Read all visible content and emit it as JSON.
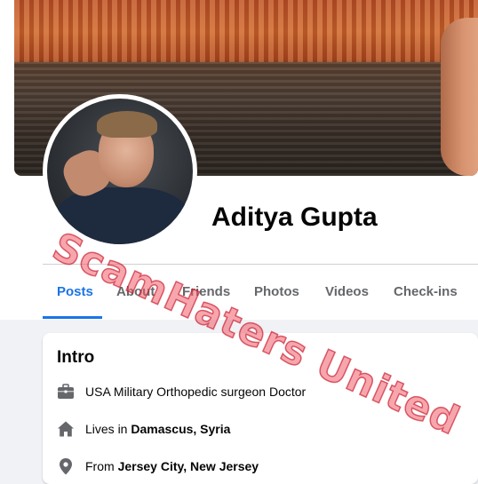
{
  "profile": {
    "name": "Aditya Gupta"
  },
  "tabs": [
    {
      "label": "Posts",
      "active": true
    },
    {
      "label": "About",
      "active": false
    },
    {
      "label": "Friends",
      "active": false
    },
    {
      "label": "Photos",
      "active": false
    },
    {
      "label": "Videos",
      "active": false
    },
    {
      "label": "Check-ins",
      "active": false
    }
  ],
  "intro": {
    "title": "Intro",
    "work": {
      "icon": "briefcase-icon",
      "text": "USA Military Orthopedic surgeon Doctor"
    },
    "lives": {
      "icon": "home-icon",
      "prefix": "Lives in ",
      "place": "Damascus, Syria"
    },
    "from": {
      "icon": "location-pin-icon",
      "prefix": "From ",
      "place": "Jersey City, New Jersey"
    }
  },
  "watermark": "ScamHaters United",
  "colors": {
    "accent": "#1b74e4",
    "watermark": "#e85b68",
    "icon": "#65676b"
  }
}
